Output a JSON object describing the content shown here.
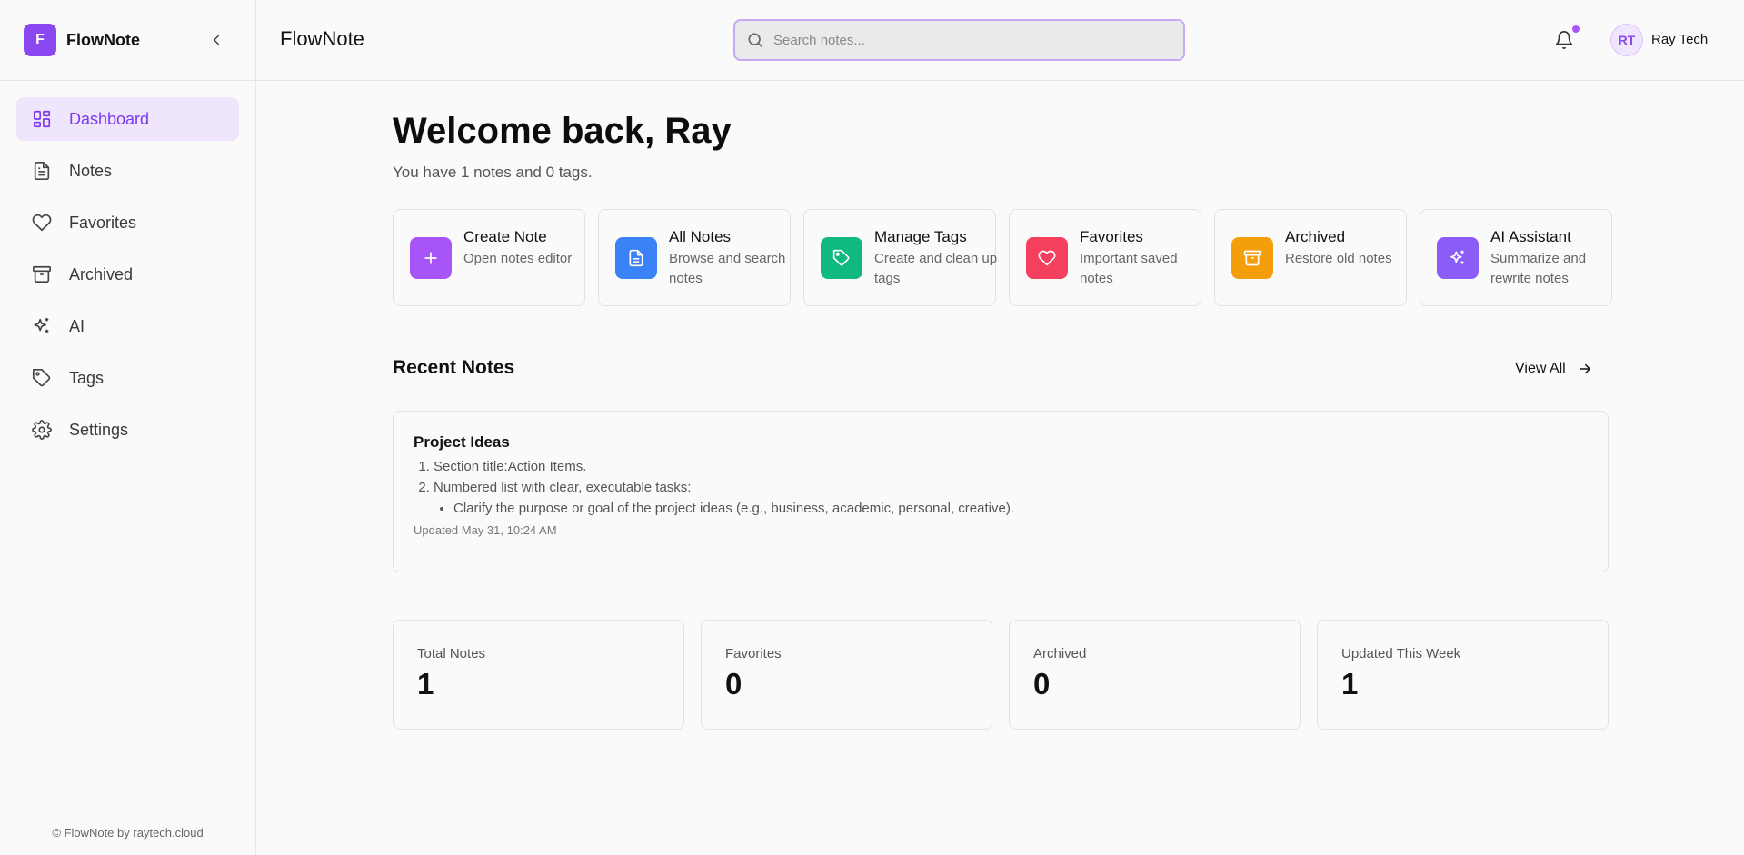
{
  "app": {
    "logo_letter": "F",
    "brand": "FlowNote"
  },
  "sidebar": {
    "items": [
      {
        "label": "Dashboard",
        "icon": "dashboard-icon",
        "active": true
      },
      {
        "label": "Notes",
        "icon": "file-text-icon",
        "active": false
      },
      {
        "label": "Favorites",
        "icon": "heart-icon",
        "active": false
      },
      {
        "label": "Archived",
        "icon": "archive-icon",
        "active": false
      },
      {
        "label": "AI",
        "icon": "sparkles-icon",
        "active": false
      },
      {
        "label": "Tags",
        "icon": "tag-icon",
        "active": false
      },
      {
        "label": "Settings",
        "icon": "gear-icon",
        "active": false
      }
    ],
    "footer": "© FlowNote by raytech.cloud"
  },
  "header": {
    "title": "FlowNote",
    "search_placeholder": "Search notes...",
    "search_value": "",
    "notifications_unread": true,
    "user_initials": "RT",
    "user_name": "Ray Tech"
  },
  "dashboard": {
    "welcome": "Welcome back, Ray",
    "summary": "You have 1 notes and 0 tags.",
    "actions": [
      {
        "title": "Create Note",
        "desc": "Open notes editor",
        "icon": "plus-icon",
        "color": "#a855f7"
      },
      {
        "title": "All Notes",
        "desc": "Browse and search notes",
        "icon": "file-text-icon",
        "color": "#3b82f6"
      },
      {
        "title": "Manage Tags",
        "desc": "Create and clean up tags",
        "icon": "tag-icon",
        "color": "#10b981"
      },
      {
        "title": "Favorites",
        "desc": "Important saved notes",
        "icon": "heart-icon",
        "color": "#f43f5e"
      },
      {
        "title": "Archived",
        "desc": "Restore old notes",
        "icon": "archive-icon",
        "color": "#f59e0b"
      },
      {
        "title": "AI Assistant",
        "desc": "Summarize and rewrite notes",
        "icon": "sparkles-icon",
        "color": "#8b5cf6"
      }
    ],
    "recent_title": "Recent Notes",
    "view_all": "View All",
    "recent_notes": [
      {
        "title": "Project Ideas",
        "items": [
          "Section title:Action Items.",
          "Numbered list with clear, executable tasks:"
        ],
        "subitems": [
          "Clarify the purpose or goal of the project ideas (e.g., business, academic, personal, creative)."
        ],
        "updated": "Updated May 31, 10:24 AM"
      }
    ],
    "stats": [
      {
        "label": "Total Notes",
        "value": "1"
      },
      {
        "label": "Favorites",
        "value": "0"
      },
      {
        "label": "Archived",
        "value": "0"
      },
      {
        "label": "Updated This Week",
        "value": "1"
      }
    ]
  },
  "colors": {
    "accent": "#8b47f0",
    "active_bg": "#efe5fd",
    "border": "#e5e5e5"
  }
}
